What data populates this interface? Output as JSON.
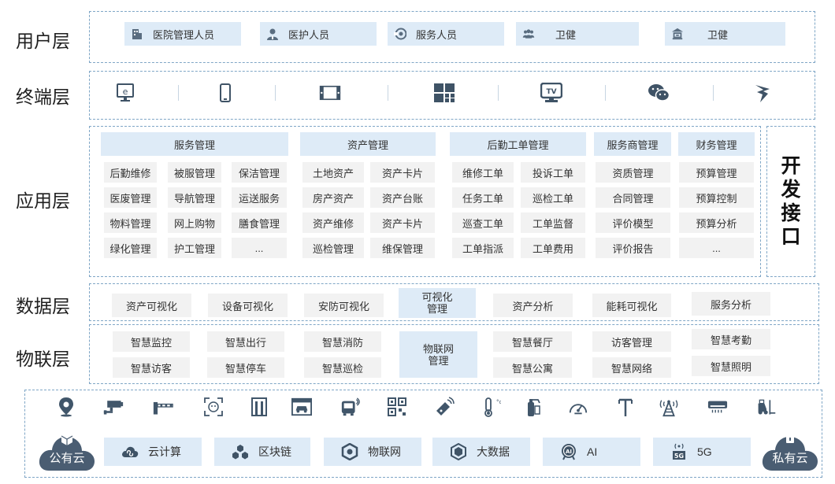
{
  "layers": {
    "user": "用户层",
    "terminal": "终端层",
    "application": "应用层",
    "data": "数据层",
    "iot": "物联层"
  },
  "user_roles": [
    "医院管理人员",
    "医护人员",
    "服务人员",
    "卫健",
    "卫健"
  ],
  "terminal_icons": [
    "ie-browser-icon",
    "mobile-phone-icon",
    "display-screen-icon",
    "dashboard-grid-icon",
    "tv-icon",
    "wechat-icon",
    "miniapp-icon"
  ],
  "app": {
    "service": {
      "title": "服务管理",
      "rows": [
        [
          "后勤维修",
          "被服管理",
          "保洁管理"
        ],
        [
          "医废管理",
          "导航管理",
          "运送服务"
        ],
        [
          "物料管理",
          "网上购物",
          "膳食管理"
        ],
        [
          "绿化管理",
          "护工管理",
          "..."
        ]
      ]
    },
    "asset": {
      "title": "资产管理",
      "rows": [
        [
          "土地资产",
          "资产卡片"
        ],
        [
          "房产资产",
          "资产台账"
        ],
        [
          "资产维修",
          "资产卡片"
        ],
        [
          "巡检管理",
          "维保管理"
        ]
      ]
    },
    "workorder": {
      "title": "后勤工单管理",
      "rows": [
        [
          "维修工单",
          "投诉工单"
        ],
        [
          "任务工单",
          "巡检工单"
        ],
        [
          "巡查工单",
          "工单监督"
        ],
        [
          "工单指派",
          "工单费用"
        ]
      ]
    },
    "vendor": {
      "title": "服务商管理",
      "rows": [
        "资质管理",
        "合同管理",
        "评价模型",
        "评价报告"
      ]
    },
    "finance": {
      "title": "财务管理",
      "rows": [
        "预算管理",
        "预算控制",
        "预算分析",
        "..."
      ]
    }
  },
  "dev_interface": [
    "开",
    "发",
    "接",
    "口"
  ],
  "data_items": [
    "资产可视化",
    "设备可视化",
    "安防可视化",
    "可视化",
    "管理",
    "资产分析",
    "能耗可视化",
    "服务分析"
  ],
  "iot": {
    "top": [
      "智慧监控",
      "智慧出行",
      "智慧消防",
      "智慧餐厅",
      "访客管理",
      "智慧考勤"
    ],
    "bottom": [
      "智慧访客",
      "智慧停车",
      "智慧巡检",
      "智慧公寓",
      "智慧网络",
      "智慧照明"
    ],
    "center": [
      "物联网",
      "管理"
    ]
  },
  "device_icons": [
    "location-icon",
    "camera-icon",
    "barrier-gate-icon",
    "face-recognition-icon",
    "access-door-icon",
    "parking-icon",
    "bus-icon",
    "qr-code-icon",
    "rfid-tag-icon",
    "thermometer-icon",
    "fire-extinguisher-icon",
    "gauge-icon",
    "antenna-icon",
    "tower-icon",
    "air-conditioner-icon",
    "forklift-icon"
  ],
  "clouds": {
    "public": "公有云",
    "private": "私有云"
  },
  "services": [
    "云计算",
    "区块链",
    "物联网",
    "大数据",
    "AI",
    "5G"
  ],
  "colors": {
    "accent_bg": "#deebf7",
    "cell_bg": "#f2f2f2",
    "border": "#7fa6c6",
    "cloud": "#4a5d72"
  }
}
